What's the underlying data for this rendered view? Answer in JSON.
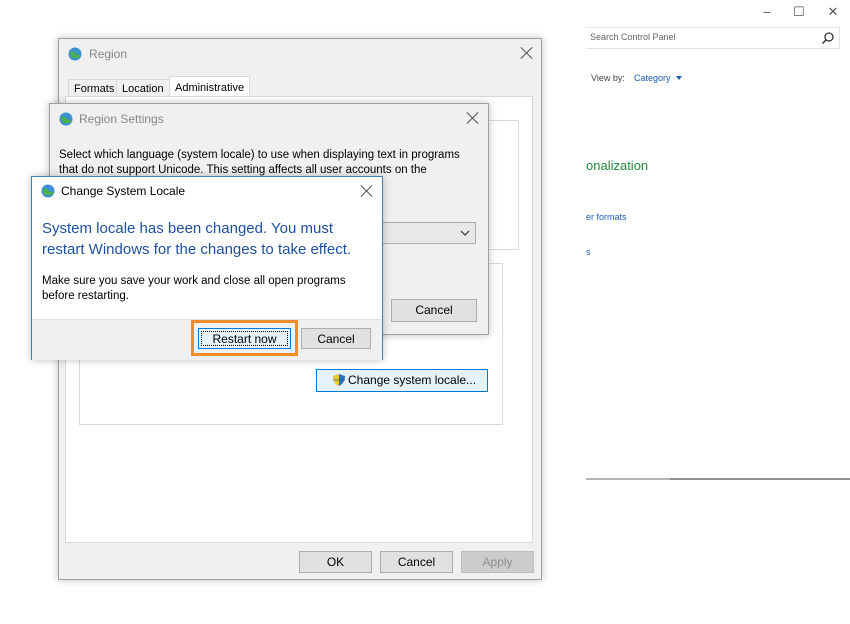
{
  "control_panel": {
    "search_placeholder": "Search Control Panel",
    "view_by_label": "View by:",
    "view_by_value": "Category",
    "category_heading_fragment": "onalization",
    "link_fragment_1": "er formats",
    "link_fragment_2": "s",
    "minimize_glyph": "–",
    "maximize_glyph": "☐",
    "close_glyph": "✕"
  },
  "region_window": {
    "title": "Region",
    "tabs": [
      "Formats",
      "Location",
      "Administrative"
    ],
    "change_locale_button": "Change system locale...",
    "ok_button": "OK",
    "cancel_button": "Cancel",
    "apply_button": "Apply"
  },
  "region_settings": {
    "title": "Region Settings",
    "description_line1": "Select which language (system locale) to use when displaying text in programs",
    "description_line2": "that do not support Unicode. This setting affects all user accounts on the",
    "cancel_button": "Cancel"
  },
  "change_locale_dialog": {
    "title": "Change System Locale",
    "main_line1": "System locale has been changed. You must",
    "main_line2": "restart Windows for the changes to take effect.",
    "sub_line1": "Make sure you save your work and close all open programs",
    "sub_line2": "before restarting.",
    "restart_button": "Restart now",
    "cancel_button": "Cancel"
  },
  "colors": {
    "highlight_orange": "#f08c2c",
    "dialog_blue_text": "#1e50a0",
    "link_blue": "#1a5fb4",
    "green_heading": "#1e8a3a"
  }
}
